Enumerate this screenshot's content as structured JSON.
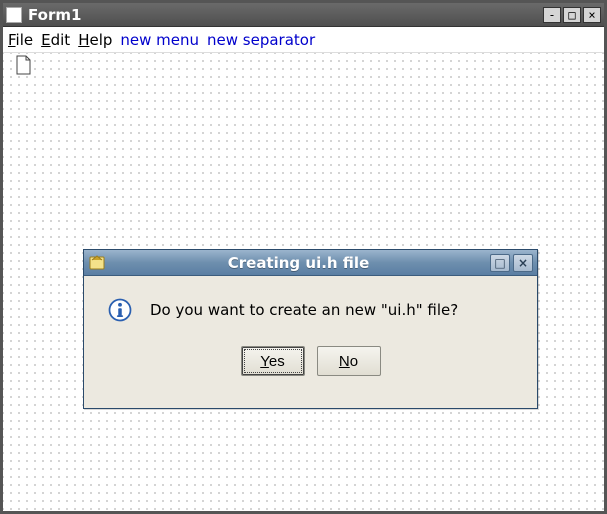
{
  "main_window": {
    "title": "Form1",
    "controls": {
      "minimize": "-",
      "maximize": "□",
      "close": "×"
    }
  },
  "menubar": {
    "items": [
      {
        "label": "File",
        "accel": "F"
      },
      {
        "label": "Edit",
        "accel": "E"
      },
      {
        "label": "Help",
        "accel": "H"
      }
    ],
    "actions": [
      {
        "label": "new menu"
      },
      {
        "label": "new separator"
      }
    ]
  },
  "canvas": {
    "doc_icon": "document-icon"
  },
  "dialog": {
    "title": "Creating ui.h file",
    "message": "Do you want to create an new \"ui.h\" file?",
    "buttons": {
      "yes": "Yes",
      "no": "No"
    },
    "controls": {
      "maximize": "□",
      "close": "×"
    }
  }
}
